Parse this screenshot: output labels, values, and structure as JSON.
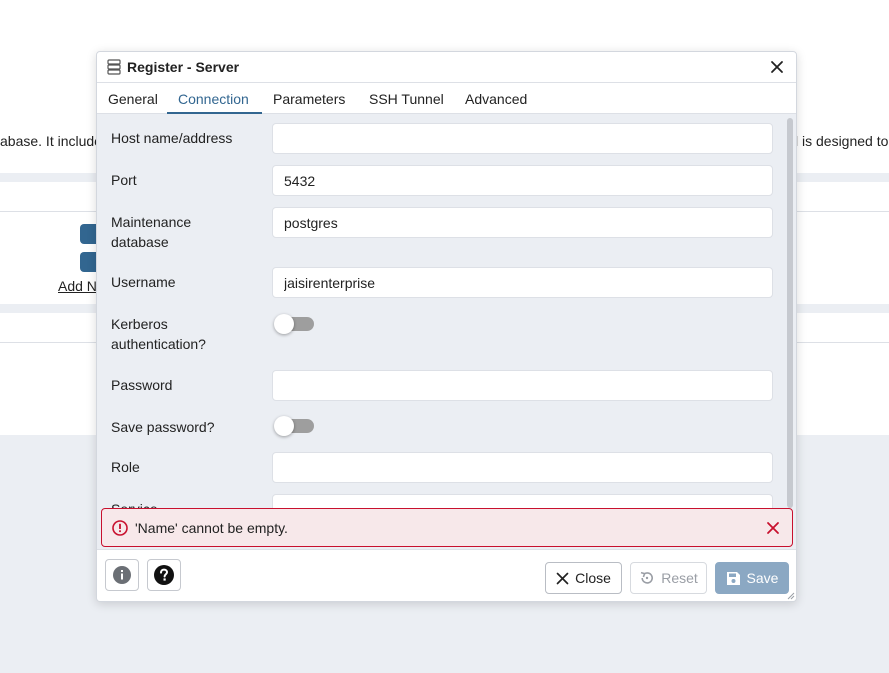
{
  "background": {
    "text_left": "abase. It include",
    "text_right": "l is designed to",
    "add_link": "Add N"
  },
  "dialog": {
    "title": "Register - Server",
    "title_icon": "server-icon",
    "close_icon": "close-icon"
  },
  "tabs": [
    {
      "label": "General",
      "active": false
    },
    {
      "label": "Connection",
      "active": true
    },
    {
      "label": "Parameters",
      "active": false
    },
    {
      "label": "SSH Tunnel",
      "active": false
    },
    {
      "label": "Advanced",
      "active": false
    }
  ],
  "form": {
    "host": {
      "label": "Host name/address",
      "value": ""
    },
    "port": {
      "label": "Port",
      "value": "5432"
    },
    "maintenance_db": {
      "label_line1": "Maintenance",
      "label_line2": "database",
      "value": "postgres"
    },
    "username": {
      "label": "Username",
      "value": "jaisirenterprise"
    },
    "kerberos": {
      "label_line1": "Kerberos",
      "label_line2": "authentication?",
      "checked": false
    },
    "password": {
      "label": "Password",
      "value": ""
    },
    "save_password": {
      "label": "Save password?",
      "checked": false
    },
    "role": {
      "label": "Role",
      "value": ""
    },
    "service": {
      "label": "Service",
      "value": ""
    }
  },
  "error": {
    "message": "'Name' cannot be empty.",
    "icon": "error-circle-icon",
    "close_icon": "close-icon",
    "color": "#c8102e"
  },
  "footer": {
    "info_icon": "info-icon",
    "help_icon": "help-icon",
    "close_label": "Close",
    "reset_label": "Reset",
    "save_label": "Save"
  },
  "colors": {
    "accent": "#326690",
    "save_disabled": "#8ba8c3",
    "panel_bg": "#ebeef3"
  }
}
